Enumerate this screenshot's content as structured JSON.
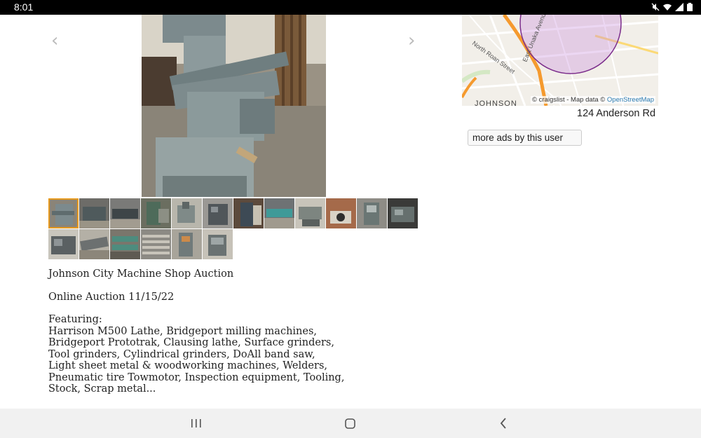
{
  "status_bar": {
    "time": "8:01",
    "icons": [
      "mute-icon",
      "wifi-icon",
      "signal-icon",
      "battery-icon"
    ]
  },
  "gallery": {
    "prev_label": "‹",
    "next_label": "›",
    "main_photo": "milling-machine-photo",
    "thumbnail_count": 18,
    "selected_index": 0,
    "selected_color": "#e79a1e"
  },
  "map": {
    "attribution_prefix": "© craigslist - Map data © ",
    "attribution_link": "OpenStreetMap",
    "street_labels": [
      "North Roan Street",
      "East Unaka Avenue",
      "JOHNSON"
    ],
    "radius_color": "#7b2d8b"
  },
  "address": "124 Anderson Rd",
  "more_ads_label": "more ads by this user",
  "posting": {
    "title": "Johnson City Machine Shop Auction",
    "subtitle": "Online Auction 11/15/22",
    "featuring_label": "Featuring:",
    "lines": [
      "Harrison M500 Lathe, Bridgeport milling machines,",
      "Bridgeport Prototrak, Clausing lathe, Surface grinders,",
      "Tool grinders, Cylindrical grinders, DoAll band saw,",
      "Light sheet metal & woodworking machines, Welders,",
      "Pneumatic tire Towmotor, Inspection equipment, Tooling,",
      "Stock, Scrap metal..."
    ]
  },
  "nav_bar": {
    "buttons": [
      "recent-apps-icon",
      "home-icon",
      "back-icon"
    ]
  }
}
